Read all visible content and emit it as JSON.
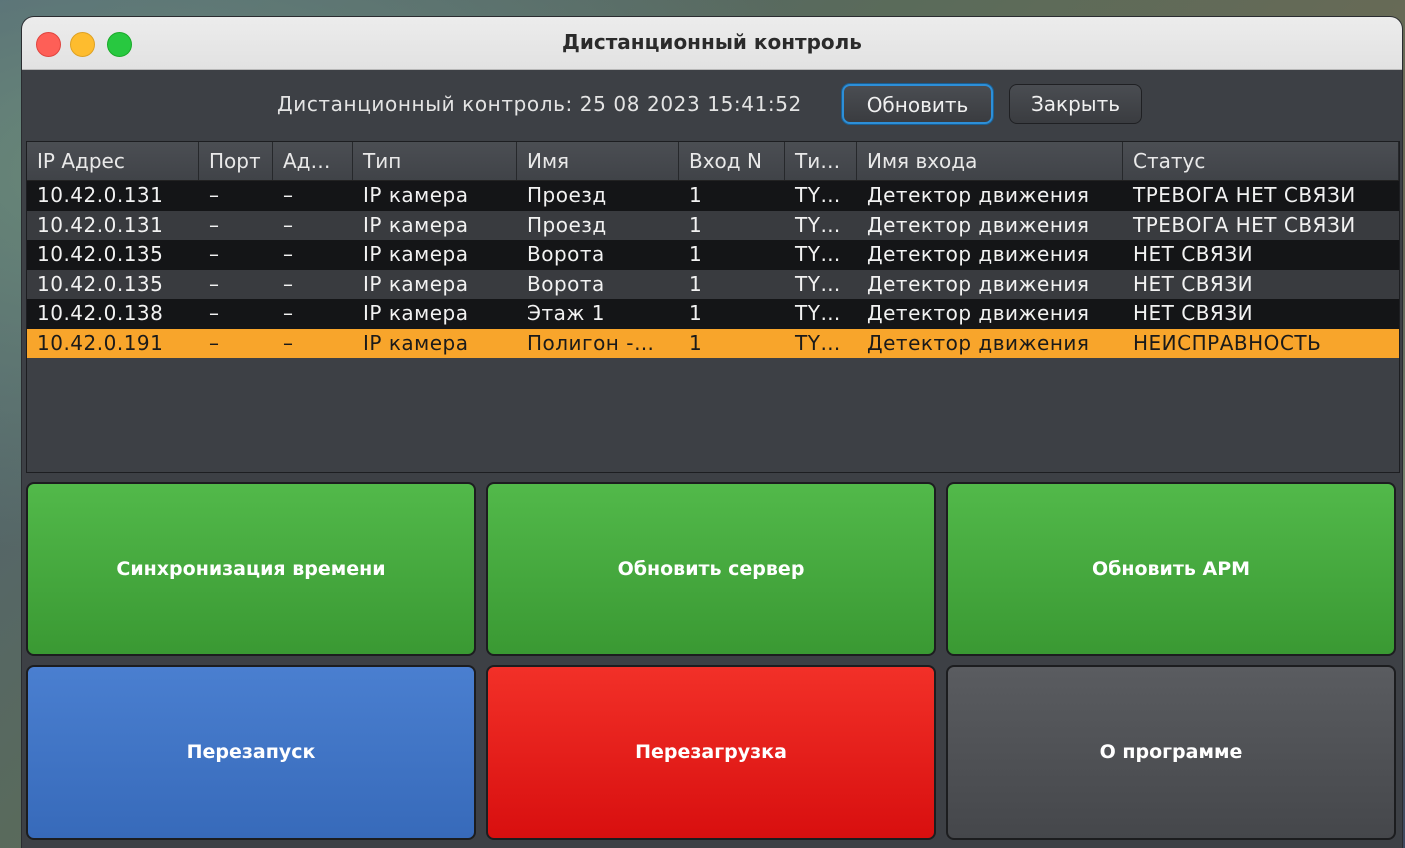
{
  "window": {
    "title": "Дистанционный контроль"
  },
  "toolbar": {
    "status_text": "Дистанционный контроль: 25 08 2023 15:41:52",
    "refresh_label": "Обновить",
    "close_label": "Закрыть"
  },
  "table": {
    "columns": [
      "IP Адрес",
      "Порт",
      "Ад…",
      "Тип",
      "Имя",
      "Вход N",
      "Ти…",
      "Имя входа",
      "Статус"
    ],
    "rows": [
      [
        "10.42.0.131",
        "–",
        "–",
        "IP камера",
        "Проезд",
        "1",
        "TY…",
        "Детектор движения",
        "ТРЕВОГА НЕТ СВЯЗИ"
      ],
      [
        "10.42.0.131",
        "–",
        "–",
        "IP камера",
        "Проезд",
        "1",
        "TY…",
        "Детектор движения",
        "ТРЕВОГА НЕТ СВЯЗИ"
      ],
      [
        "10.42.0.135",
        "–",
        "–",
        "IP камера",
        "Ворота",
        "1",
        "TY…",
        "Детектор движения",
        "НЕТ СВЯЗИ"
      ],
      [
        "10.42.0.135",
        "–",
        "–",
        "IP камера",
        "Ворота",
        "1",
        "TY…",
        "Детектор движения",
        "НЕТ СВЯЗИ"
      ],
      [
        "10.42.0.138",
        "–",
        "–",
        "IP камера",
        "Этаж 1",
        "1",
        "TY…",
        "Детектор движения",
        "НЕТ СВЯЗИ"
      ],
      [
        "10.42.0.191",
        "–",
        "–",
        "IP камера",
        "Полигон -…",
        "1",
        "TY…",
        "Детектор движения",
        "НЕИСПРАВНОСТЬ"
      ]
    ],
    "selected_row_color": "#f8a52b"
  },
  "actions": {
    "sync_time": "Синхронизация времени",
    "update_server": "Обновить сервер",
    "update_arm": "Обновить АРМ",
    "restart": "Перезапуск",
    "reboot": "Перезагрузка",
    "about": "О программе"
  },
  "colors": {
    "green": "#4aae42",
    "blue": "#4274c4",
    "red": "#e41f1b",
    "gray": "#4f5155",
    "focus": "#2d8fd8"
  }
}
